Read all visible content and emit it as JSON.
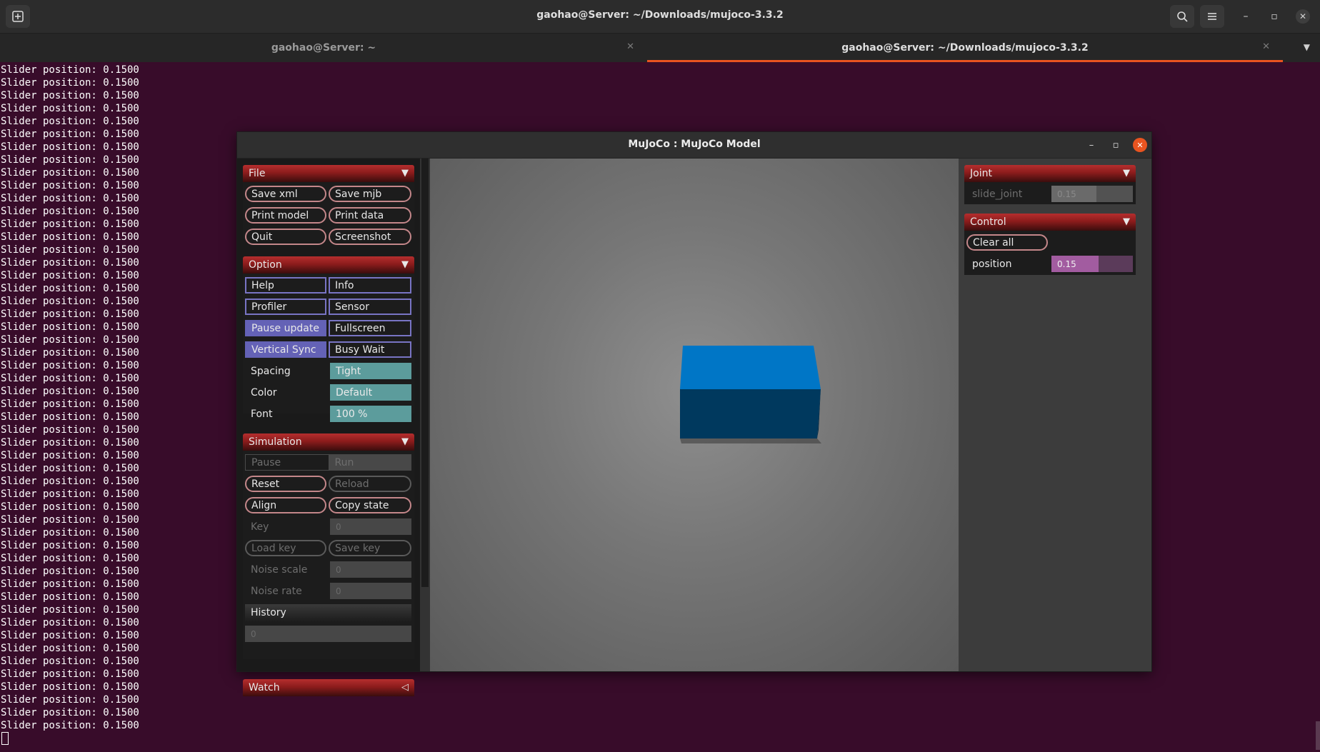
{
  "terminal": {
    "window_title": "gaohao@Server: ~/Downloads/mujoco-3.3.2",
    "tabs": [
      {
        "label": "gaohao@Server: ~",
        "active": false
      },
      {
        "label": "gaohao@Server: ~/Downloads/mujoco-3.3.2",
        "active": true
      }
    ],
    "line_text": "Slider position: 0.1500",
    "line_count": 52,
    "accent": "#e95420",
    "background": "#380c2a"
  },
  "mujoco": {
    "title": "MuJoCo : MuJoCo Model",
    "file": {
      "header": "File",
      "buttons": [
        "Save xml",
        "Save mjb",
        "Print model",
        "Print data",
        "Quit",
        "Screenshot"
      ]
    },
    "option": {
      "header": "Option",
      "checks": [
        {
          "label": "Help",
          "on": false
        },
        {
          "label": "Info",
          "on": false
        },
        {
          "label": "Profiler",
          "on": false
        },
        {
          "label": "Sensor",
          "on": false
        },
        {
          "label": "Pause update",
          "on": true
        },
        {
          "label": "Fullscreen",
          "on": false
        },
        {
          "label": "Vertical Sync",
          "on": true
        },
        {
          "label": "Busy Wait",
          "on": false
        }
      ],
      "selects": [
        {
          "label": "Spacing",
          "value": "Tight"
        },
        {
          "label": "Color",
          "value": "Default"
        },
        {
          "label": "Font",
          "value": "100 %"
        }
      ]
    },
    "simulation": {
      "header": "Simulation",
      "radio": [
        "Pause",
        "Run"
      ],
      "reset": "Reset",
      "reload": "Reload",
      "align": "Align",
      "copy_state": "Copy state",
      "key_label": "Key",
      "key_value": "0",
      "load_key": "Load key",
      "save_key": "Save key",
      "noise_scale_label": "Noise scale",
      "noise_scale_value": "0",
      "noise_rate_label": "Noise rate",
      "noise_rate_value": "0",
      "history_header": "History",
      "history_value": "0"
    },
    "watch": {
      "header": "Watch"
    },
    "joint": {
      "header": "Joint",
      "name": "slide_joint",
      "value": "0.15",
      "fill": 0.55
    },
    "control": {
      "header": "Control",
      "clear_all": "Clear all",
      "name": "position",
      "value": "0.15",
      "fill": 0.58
    },
    "colors": {
      "section_header": "#8c1c1c",
      "check_on": "#6462b6",
      "select_bg": "#5c9c9c",
      "control_fill": "#a25ca0",
      "box_top": "#0076c6",
      "box_front": "#00395e"
    }
  }
}
